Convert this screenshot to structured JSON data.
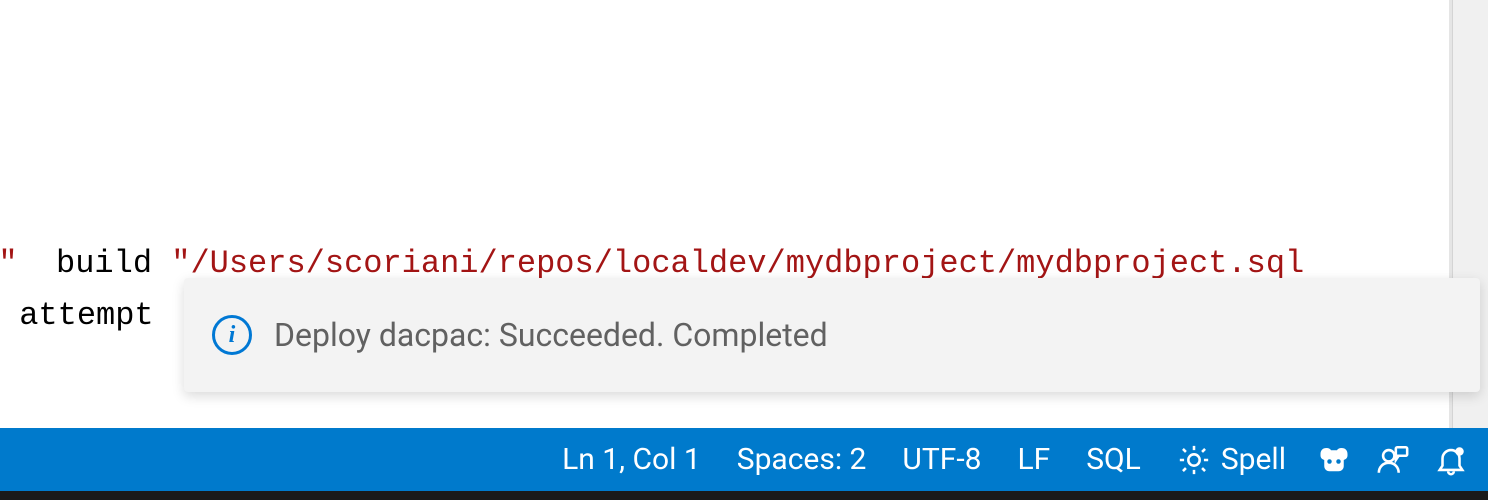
{
  "editor": {
    "line1_part1": "et\"  ",
    "line1_part2": "build ",
    "line1_part3": "\"/Users/scoriani/repos/localdev/mydbproject/mydbproject.sql",
    "line2_part1": " attempt"
  },
  "notification": {
    "message": "Deploy dacpac: Succeeded. Completed"
  },
  "statusbar": {
    "position": "Ln 1, Col 1",
    "spaces": "Spaces: 2",
    "encoding": "UTF-8",
    "eol": "LF",
    "language": "SQL",
    "spell": "Spell"
  }
}
